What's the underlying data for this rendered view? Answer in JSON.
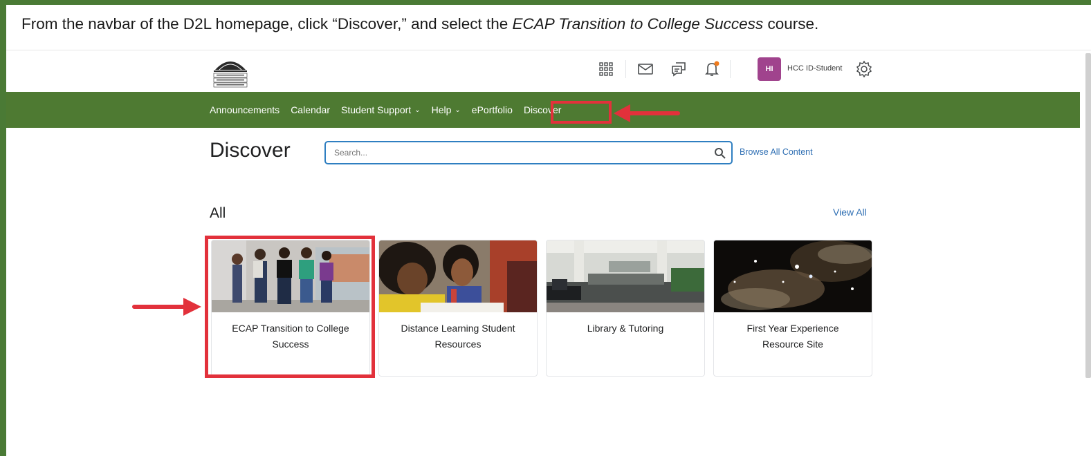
{
  "instruction": {
    "part1": "From the navbar of the D2L homepage, click “Discover,” and select the ",
    "course_em": "ECAP Transition to College Success",
    "part2": " course."
  },
  "minibar": {
    "logo_alt": "HAGERSTOWN COMMUNITY COLLEGE",
    "icons": [
      "grid-icon",
      "mail-icon",
      "chat-icon",
      "bell-icon"
    ],
    "avatar_initials": "HI",
    "username": "HCC ID-Student"
  },
  "navbar": {
    "items": [
      {
        "label": "Announcements",
        "dropdown": false
      },
      {
        "label": "Calendar",
        "dropdown": false
      },
      {
        "label": "Student Support",
        "dropdown": true
      },
      {
        "label": "Help",
        "dropdown": true
      },
      {
        "label": "ePortfolio",
        "dropdown": false
      },
      {
        "label": "Discover",
        "dropdown": false
      }
    ]
  },
  "discover": {
    "title": "Discover",
    "search_placeholder": "Search...",
    "browse_all": "Browse All Content"
  },
  "section": {
    "title": "All",
    "view_all": "View All"
  },
  "cards": [
    {
      "title": "ECAP Transition to College Success"
    },
    {
      "title": "Distance Learning Student Resources"
    },
    {
      "title": "Library & Tutoring"
    },
    {
      "title": "First Year Experience Resource Site"
    }
  ],
  "colors": {
    "navbar": "#4e7a32",
    "frame": "#4a7a35",
    "highlight": "#e2313b",
    "link": "#2f6fb3",
    "avatar": "#a0438d",
    "notification_dot": "#f07b1d"
  }
}
